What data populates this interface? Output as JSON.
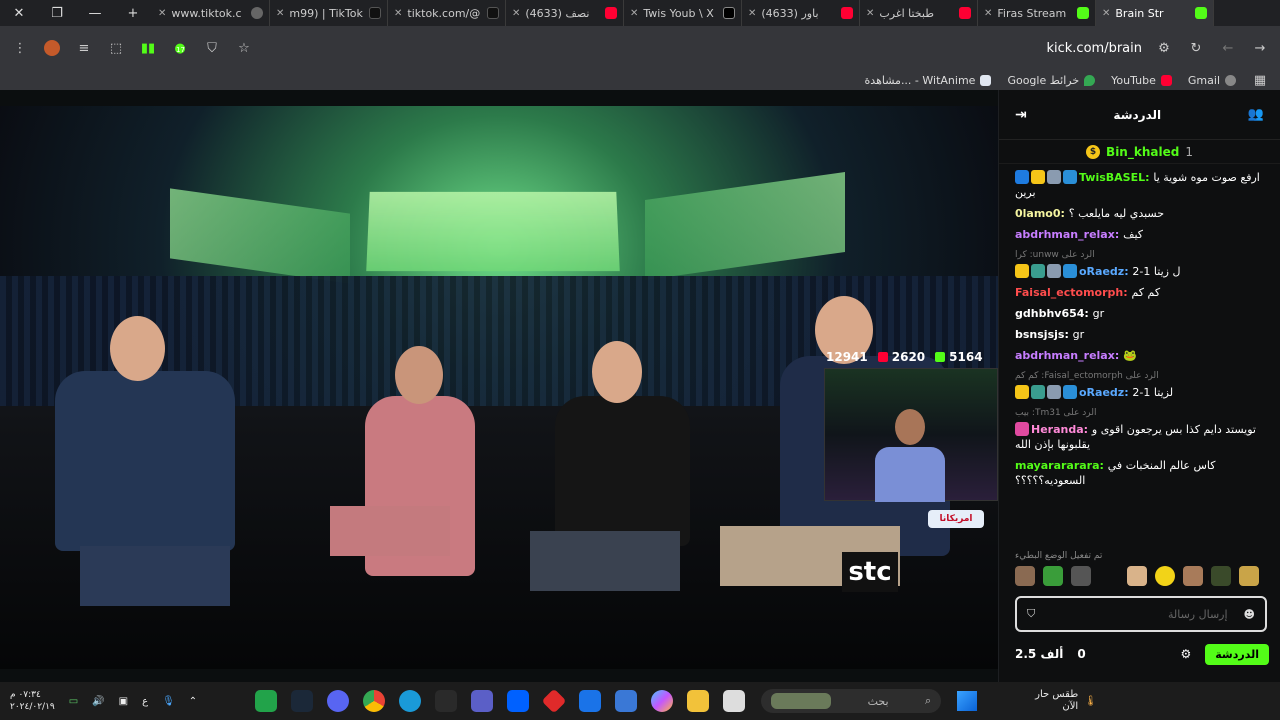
{
  "browser": {
    "tabs": [
      {
        "title": "www.tiktok.c",
        "icon": "globe"
      },
      {
        "title": "m99) | TikTok",
        "icon": "tiktok"
      },
      {
        "title": "tiktok.com/@",
        "icon": "tiktok"
      },
      {
        "title": "(4633) نصف",
        "icon": "youtube"
      },
      {
        "title": "Twis Youb \\ X",
        "icon": "x"
      },
      {
        "title": "(4633) باور",
        "icon": "youtube"
      },
      {
        "title": "طبختا اغرب",
        "icon": "youtube"
      },
      {
        "title": "Firas Stream",
        "icon": "kick"
      },
      {
        "title": "Brain Str",
        "icon": "kick"
      }
    ],
    "url": "kick.com/brain",
    "bookmarks": [
      {
        "label": "Gmail",
        "icon": "globe"
      },
      {
        "label": "YouTube",
        "icon": "youtube"
      },
      {
        "label": "Google خرائط",
        "icon": "maps"
      },
      {
        "label": "مشاهدة... - WitAnime",
        "icon": "witanime"
      }
    ],
    "extension_badge": "17"
  },
  "stream": {
    "viewers": [
      {
        "value": "12941",
        "color": "#53fc18"
      },
      {
        "value": "2620",
        "color": "#ff0033"
      },
      {
        "value": "5164",
        "color": "#53fc18"
      }
    ],
    "sponsor_logo": "stc",
    "sponsor_badge": "امريكانا"
  },
  "chat": {
    "title": "الدردشة",
    "pinned": {
      "user": "Bin_khaled",
      "count": "1"
    },
    "messages": [
      {
        "user": "TwisBASEL",
        "color": "#53fc18",
        "text": "ارفع صوت موه شوية يا برين",
        "badges": [
          "#1e7be0",
          "#f5c518",
          "#8a9bb0",
          "#2a8fd8"
        ],
        "reply": ""
      },
      {
        "user": "0lamo0",
        "color": "#f5f5a0",
        "text": "حسبدي ليه مايلعب ؟",
        "badges": [],
        "reply": ""
      },
      {
        "user": "abdrhman_relax",
        "color": "#c77dff",
        "text": "كيف",
        "badges": [],
        "reply": ""
      },
      {
        "user": "oRaedz",
        "color": "#5aa9ff",
        "text": "ل زيتا 1-2",
        "badges": [
          "#f5c518",
          "#3a9d8f",
          "#8a9bb0",
          "#2a8fd8"
        ],
        "reply": "الرد على unww: كرا"
      },
      {
        "user": "Faisal_ectomorph",
        "color": "#ff4d4d",
        "text": "كم كم",
        "badges": [],
        "reply": ""
      },
      {
        "user": "gdhbhv654",
        "color": "#ffffff",
        "text": "gr",
        "badges": [],
        "reply": ""
      },
      {
        "user": "bsnsjsjs",
        "color": "#ffffff",
        "text": "gr",
        "badges": [],
        "reply": ""
      },
      {
        "user": "abdrhman_relax",
        "color": "#c77dff",
        "text": "🐸",
        "badges": [],
        "reply": ""
      },
      {
        "user": "oRaedz",
        "color": "#5aa9ff",
        "text": "لزيتا 1-2",
        "badges": [
          "#f5c518",
          "#3a9d8f",
          "#8a9bb0",
          "#2a8fd8"
        ],
        "reply": "الرد على Faisal_ectomorph: كم كم"
      },
      {
        "user": "Heranda",
        "color": "#ff8ad8",
        "text": "تويستد دايم كذا بس يرجعون اقوى و يقلبونها بإذن الله",
        "badges": [
          "#e04aa0"
        ],
        "reply": "الرد على Tm31: بيب"
      },
      {
        "user": "mayarararara",
        "color": "#53fc18",
        "text": "كاس عالم المنخبات في السعوديه؟؟؟؟؟",
        "badges": [],
        "reply": ""
      }
    ],
    "mode_note": "تم تفعيل الوضع البطيء",
    "input_placeholder": "إرسال رسالة",
    "followers": "2.5 ألف",
    "points": "0",
    "send_label": "الدردشة"
  },
  "taskbar": {
    "search_placeholder": "بحث",
    "time": "٠٧:٣٤ م",
    "date": "٢٠٢٤/٠٢/١٩",
    "weather_line1": "طقس حار",
    "weather_line2": "الآن",
    "lang": "ع"
  }
}
